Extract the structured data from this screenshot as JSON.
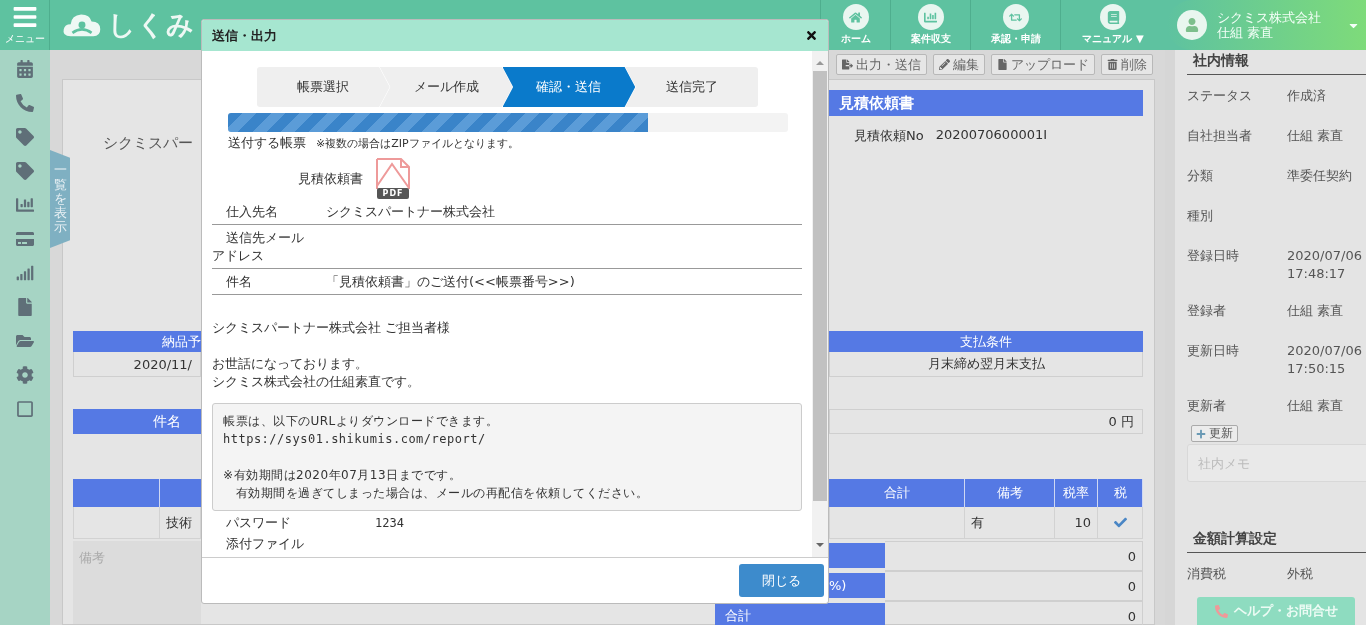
{
  "top_bar": {
    "menu_label": "メニュー",
    "logo_text": "しくみ",
    "nav": [
      {
        "kind": "home",
        "label": "ホーム"
      },
      {
        "kind": "chart",
        "label": "案件収支"
      },
      {
        "kind": "approve",
        "label": "承認・申請"
      },
      {
        "kind": "manual",
        "label": "マニュアル ▼"
      }
    ],
    "user": {
      "company": "シクミス株式会社",
      "name": "仕組 素直"
    }
  },
  "list_toggle": "一覧を表示",
  "toolbar": [
    {
      "kind": "export",
      "label": "出力・送信"
    },
    {
      "kind": "edit",
      "label": "編集"
    },
    {
      "kind": "upload",
      "label": "アップロード"
    },
    {
      "kind": "delete",
      "label": "削除"
    }
  ],
  "document": {
    "partner_fragment": "シクミスパー",
    "title": "見積依頼書",
    "number_label": "見積依頼No",
    "number": "2020070600001I"
  },
  "delivery": {
    "header": "納品予",
    "value": "2020/11/"
  },
  "payment": {
    "header": "支払条件",
    "value": "月末締め翌月末支払"
  },
  "subject_header": "件名",
  "amount": "0 円",
  "items_table": {
    "left_cells": [
      "技術"
    ],
    "columns": [
      "合計",
      "備考",
      "税率",
      "税"
    ],
    "rows": [
      {
        "remark": "有",
        "rate": "10",
        "taxed": true
      }
    ]
  },
  "notes_label": "備考",
  "totals": [
    {
      "value": "0"
    },
    {
      "label": "%)",
      "value": "0"
    },
    {
      "label": "合計",
      "value": "0"
    }
  ],
  "info_panel": {
    "title": "社内情報",
    "fields": [
      {
        "label": "ステータス",
        "value": "作成済"
      },
      {
        "label": "自社担当者",
        "value": "仕組 素直"
      },
      {
        "label": "分類",
        "value": "準委任契約"
      },
      {
        "label": "種別"
      },
      {
        "label": "登録日時",
        "value": "2020/07/06 17:48:17"
      },
      {
        "label": "登録者",
        "value": "仕組 素直"
      },
      {
        "label": "更新日時",
        "value": "2020/07/06 17:50:15"
      },
      {
        "label": "更新者",
        "value": "仕組 素直"
      }
    ],
    "update_button": "更新",
    "memo_placeholder": "社内メモ"
  },
  "calc_settings": {
    "title": "金額計算設定",
    "fields": [
      {
        "label": "消費税",
        "value": "外税"
      }
    ]
  },
  "help_button": "ヘルプ・お問合せ",
  "dialog": {
    "title": "送信・出力",
    "steps": [
      {
        "label": "帳票選択",
        "selected": false
      },
      {
        "label": "メール作成",
        "selected": false
      },
      {
        "label": "確認・送信",
        "selected": true
      },
      {
        "label": "送信完了",
        "selected": false
      }
    ],
    "progress": {
      "level": 0.75
    },
    "attach_label": "送付する帳票",
    "attach_note": "※複数の場合はZIPファイルとなります。",
    "file_name": "見積依頼書",
    "file_type": "PDF",
    "fields": [
      {
        "label": "仕入先名",
        "value": "シクミスパートナー株式会社"
      },
      {
        "label": "送信先メールアドレス"
      },
      {
        "label": "件名",
        "value": "「見積依頼書」のご送付(<<帳票番号>>)"
      }
    ],
    "body_paragraphs": [
      [
        "シクミスパートナー株式会社 ご担当者様"
      ],
      [
        "お世話になっております。",
        "シクミス株式会社の仕組素直です。"
      ]
    ],
    "notice_paragraphs": [
      [
        "帳票は、以下のURLよりダウンロードできます。",
        "https://sys01.shikumis.com/report/"
      ],
      [
        "※有効期間は2020年07月13日までです。",
        "　有効期間を過ぎてしまった場合は、メールの再配信を依頼してください。"
      ]
    ],
    "password_label": "パスワード",
    "password": "1234",
    "attachment_label": "添付ファイル",
    "close_button": "閉じる"
  }
}
